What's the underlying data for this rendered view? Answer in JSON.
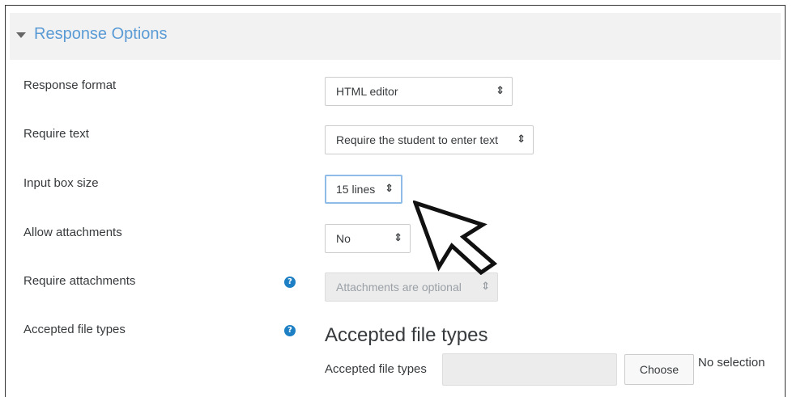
{
  "section": {
    "title": "Response Options"
  },
  "fields": {
    "response_format": {
      "label": "Response format",
      "value": "HTML editor"
    },
    "require_text": {
      "label": "Require text",
      "value": "Require the student to enter text"
    },
    "input_box_size": {
      "label": "Input box size",
      "value": "15 lines"
    },
    "allow_attachments": {
      "label": "Allow attachments",
      "value": "No"
    },
    "require_attachments": {
      "label": "Require attachments",
      "value": "Attachments are optional"
    },
    "accepted_file_types": {
      "label": "Accepted file types",
      "heading": "Accepted file types",
      "inner_label": "Accepted file types",
      "button_label": "Choose",
      "status": "No selection"
    }
  },
  "icons": {
    "help": "question-circle-icon",
    "collapse": "caret-down-icon",
    "cursor": "mouse-pointer-icon",
    "select_arrows": "updown-arrows-icon"
  },
  "colors": {
    "accent": "#5a9bd5",
    "help_icon": "#1d7fc4",
    "focus_border": "#8fbbe8"
  }
}
